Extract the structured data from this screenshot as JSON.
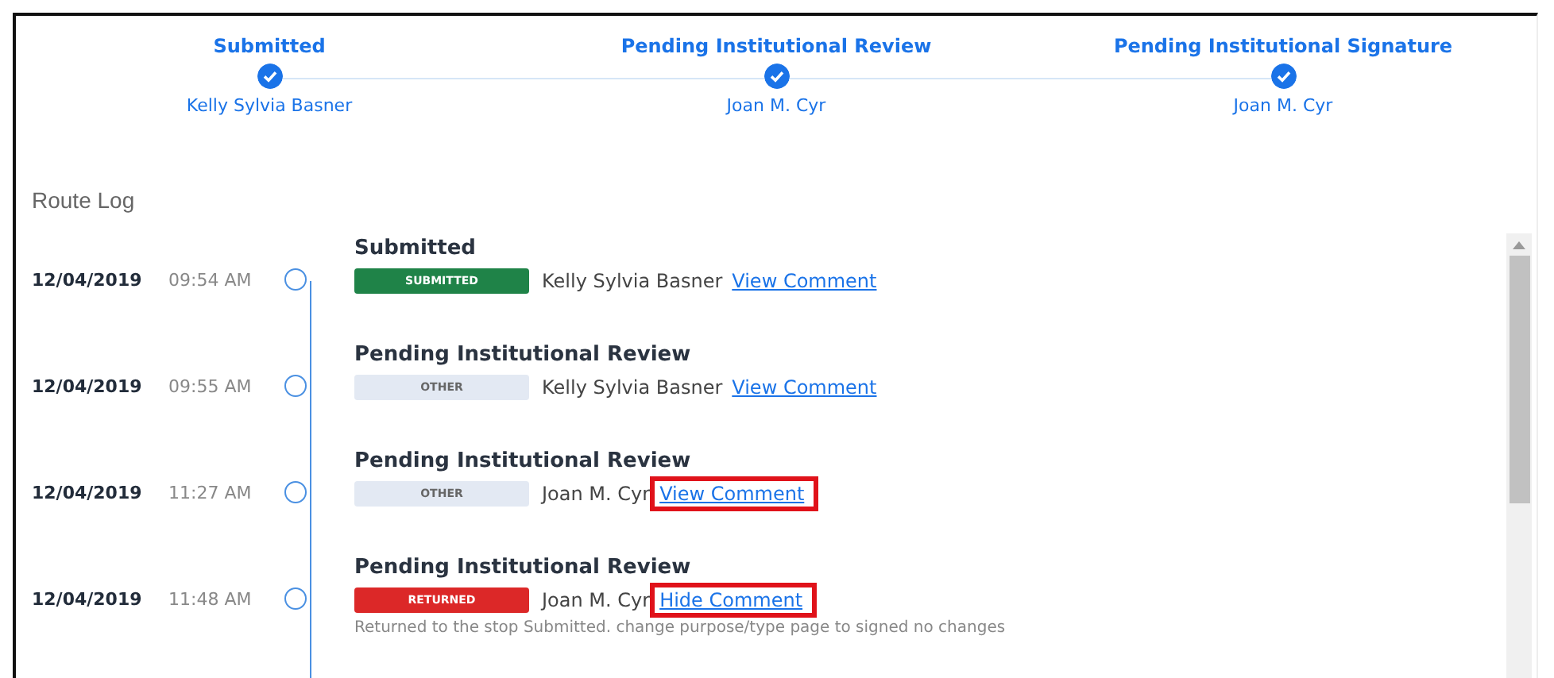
{
  "steps": [
    {
      "title": "Submitted",
      "person": "Kelly Sylvia Basner",
      "done": true
    },
    {
      "title": "Pending Institutional Review",
      "person": "Joan M. Cyr",
      "done": true
    },
    {
      "title": "Pending Institutional Signature",
      "person": "Joan M. Cyr",
      "done": true
    }
  ],
  "route_log": {
    "title": "Route Log",
    "entries": [
      {
        "date": "12/04/2019",
        "time": "09:54 AM",
        "title": "Submitted",
        "status": "SUBMITTED",
        "kind": "submitted",
        "person": "Kelly Sylvia Basner",
        "link": "View Comment",
        "highlighted": false
      },
      {
        "date": "12/04/2019",
        "time": "09:55 AM",
        "title": "Pending Institutional Review",
        "status": "OTHER",
        "kind": "other",
        "person": "Kelly Sylvia Basner",
        "link": "View Comment",
        "highlighted": false
      },
      {
        "date": "12/04/2019",
        "time": "11:27 AM",
        "title": "Pending Institutional Review",
        "status": "OTHER",
        "kind": "other",
        "person": "Joan M. Cyr",
        "link": "View Comment",
        "highlighted": true
      },
      {
        "date": "12/04/2019",
        "time": "11:48 AM",
        "title": "Pending Institutional Review",
        "status": "RETURNED",
        "kind": "returned",
        "person": "Joan M. Cyr",
        "link": "Hide Comment",
        "highlighted": true,
        "comment": "Returned to the stop Submitted. change purpose/type page to signed no changes"
      }
    ]
  }
}
